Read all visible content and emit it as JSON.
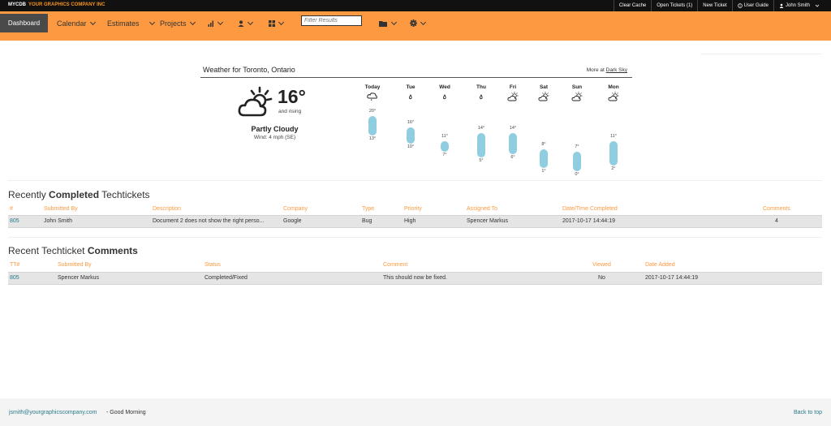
{
  "header": {
    "brand": "MYCDB",
    "company": "YOUR GRAPHICS COMPANY INC",
    "links": [
      "Clear Cache",
      "Open Tickets (1)",
      "New Ticket",
      "User Guide",
      "John Smith"
    ]
  },
  "nav": {
    "dashboard": "Dashboard",
    "calendar": "Calendar",
    "estimates": "Estimates",
    "projects": "Projects",
    "filter_placeholder": "Filter Results"
  },
  "weather": {
    "title": "Weather for Toronto, Ontario",
    "more_prefix": "More at",
    "more_link": "Dark Sky",
    "current_temp": "16°",
    "trend": "and rising",
    "condition": "Partly Cloudy",
    "wind": "Wind: 4 mph (SE)",
    "days": [
      {
        "name": "Today",
        "icon": "rain-cloud-icon",
        "hi": "20°",
        "lo": "13°",
        "hi_val": 20,
        "lo_val": 13
      },
      {
        "name": "Tue",
        "icon": "rain-drop-icon",
        "hi": "16°",
        "lo": "10°",
        "hi_val": 16,
        "lo_val": 10
      },
      {
        "name": "Wed",
        "icon": "rain-drop-icon",
        "hi": "11°",
        "lo": "7°",
        "hi_val": 11,
        "lo_val": 7
      },
      {
        "name": "Thu",
        "icon": "rain-drop-icon",
        "hi": "14°",
        "lo": "5°",
        "hi_val": 14,
        "lo_val": 5
      },
      {
        "name": "Fri",
        "icon": "partly-cloudy-icon",
        "hi": "14°",
        "lo": "6°",
        "hi_val": 14,
        "lo_val": 6
      },
      {
        "name": "Sat",
        "icon": "partly-cloudy-icon",
        "hi": "8°",
        "lo": "1°",
        "hi_val": 8,
        "lo_val": 1
      },
      {
        "name": "Sun",
        "icon": "partly-cloudy-icon",
        "hi": "7°",
        "lo": "0°",
        "hi_val": 7,
        "lo_val": 0
      },
      {
        "name": "Mon",
        "icon": "partly-cloudy-icon",
        "hi": "11°",
        "lo": "2°",
        "hi_val": 11,
        "lo_val": 2
      }
    ]
  },
  "completed": {
    "title_pre": "Recently",
    "title_bold": "Completed",
    "title_post": "Techtickets",
    "columns": [
      "#",
      "Submitted By",
      "Description",
      "Company",
      "Type",
      "Priority",
      "Assigned To",
      "Date/Time Completed",
      "Comments"
    ],
    "rows": [
      [
        "805",
        "John Smith",
        "Document 2 does not show the right perso...",
        "Google",
        "Bug",
        "High",
        "Spencer Markus",
        "2017-10-17 14:44:19",
        "4"
      ]
    ]
  },
  "comments": {
    "title_pre": "Recent Techticket",
    "title_bold": "Comments",
    "columns": [
      "TT#",
      "Submitted By",
      "Status",
      "Comment",
      "Viewed",
      "Date Added"
    ],
    "rows": [
      [
        "805",
        "Spencer Markus",
        "Completed/Fixed",
        "This should now be fixed.",
        "No",
        "2017-10-17 14:44:19"
      ]
    ]
  },
  "footer": {
    "email": "jsmith@yourgraphicscompany.com",
    "greeting": "- Good Morning",
    "back_to_top": "Back to top"
  }
}
